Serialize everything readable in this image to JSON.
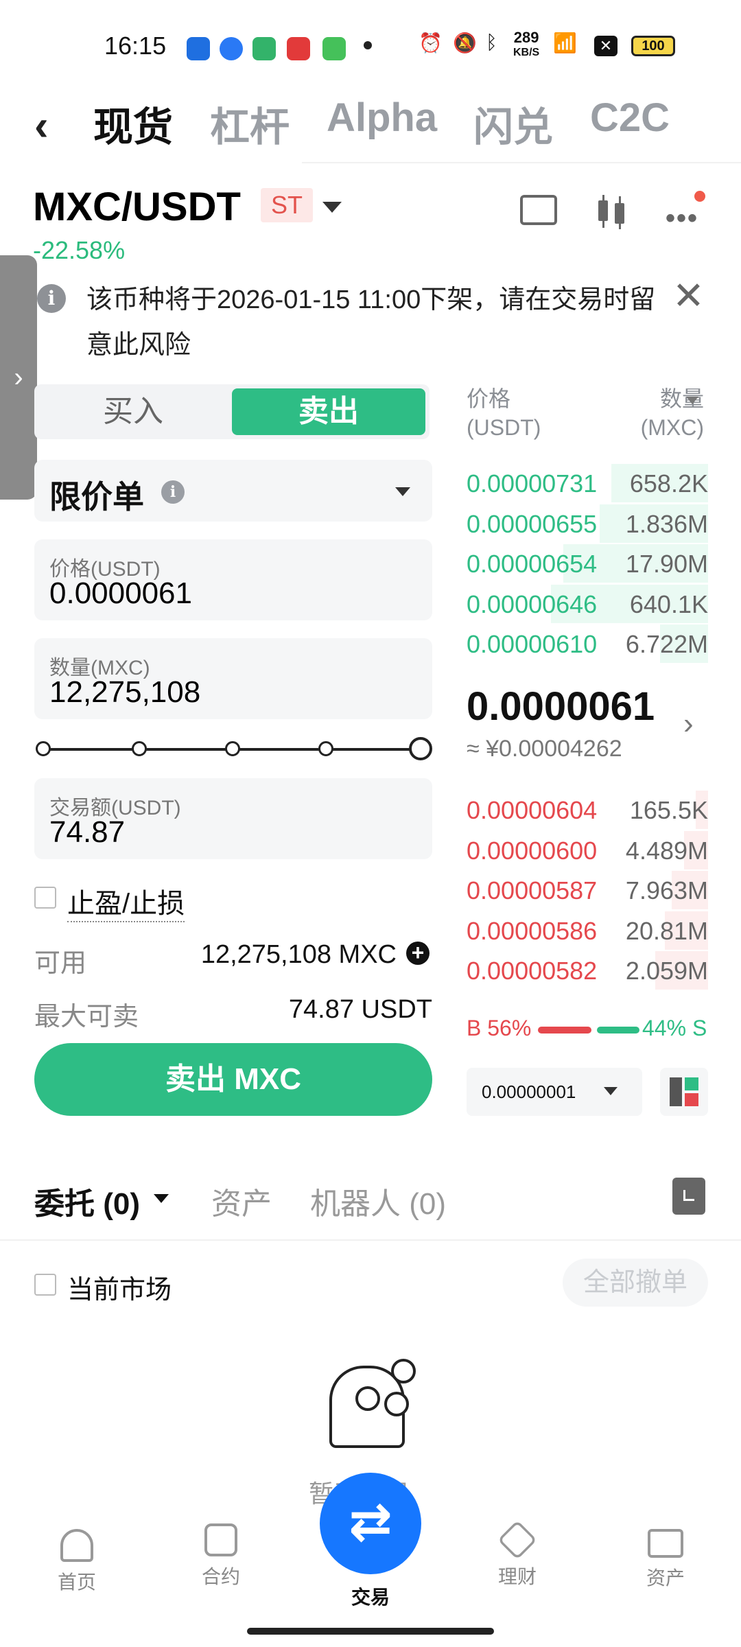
{
  "status_bar": {
    "time": "16:15",
    "net_speed": "289",
    "net_unit": "KB/S",
    "battery": "100"
  },
  "nav": {
    "tabs": [
      "现货",
      "杠杆",
      "Alpha",
      "闪兑",
      "C2C"
    ],
    "active": 0
  },
  "pair": {
    "symbol": "MXC/USDT",
    "badge": "ST",
    "change": "-22.58%"
  },
  "notice": {
    "text": "该币种将于2026-01-15 11:00下架，请在交易时留意此风险"
  },
  "trade_form": {
    "side_buy": "买入",
    "side_sell": "卖出",
    "order_type": "限价单",
    "price_label": "价格(USDT)",
    "price_value": "0.0000061",
    "qty_label": "数量(MXC)",
    "qty_value": "12,275,108",
    "slider_percent": 100,
    "amount_label": "交易额(USDT)",
    "amount_value": "74.87",
    "tpsl_label": "止盈/止损",
    "available_label": "可用",
    "available_value": "12,275,108 MXC",
    "max_sell_label": "最大可卖",
    "max_sell_value": "74.87 USDT",
    "submit_label": "卖出 MXC"
  },
  "orderbook": {
    "price_header": "价格",
    "price_unit": "(USDT)",
    "qty_header": "数量",
    "qty_unit": "(MXC)",
    "asks": [
      {
        "price": "0.00000731",
        "qty": "658.2K",
        "depth": 0.4
      },
      {
        "price": "0.00000655",
        "qty": "1.836M",
        "depth": 0.45
      },
      {
        "price": "0.00000654",
        "qty": "17.90M",
        "depth": 0.6
      },
      {
        "price": "0.00000646",
        "qty": "640.1K",
        "depth": 0.65
      },
      {
        "price": "0.00000610",
        "qty": "6.722M",
        "depth": 0.2
      }
    ],
    "last_price": "0.0000061",
    "last_price_cny": "≈ ¥0.00004262",
    "bids": [
      {
        "price": "0.00000604",
        "qty": "165.5K",
        "depth": 0.05
      },
      {
        "price": "0.00000600",
        "qty": "4.489M",
        "depth": 0.1
      },
      {
        "price": "0.00000587",
        "qty": "7.963M",
        "depth": 0.15
      },
      {
        "price": "0.00000586",
        "qty": "20.81M",
        "depth": 0.18
      },
      {
        "price": "0.00000582",
        "qty": "2.059M",
        "depth": 0.22
      }
    ],
    "buy_ratio": "B 56%",
    "sell_ratio": "44% S",
    "precision": "0.00000001"
  },
  "bottom_tabs": {
    "orders": "委托 (0)",
    "assets": "资产",
    "bots": "机器人 (0)"
  },
  "filter": {
    "current_market": "当前市场",
    "cancel_all": "全部撤单"
  },
  "empty_state": {
    "text": "暂无数据"
  },
  "bottom_nav": [
    "首页",
    "合约",
    "交易",
    "理财",
    "资产"
  ],
  "colors": {
    "green": "#2ebd85",
    "red": "#e5484d",
    "fab_blue": "#1677ff"
  }
}
